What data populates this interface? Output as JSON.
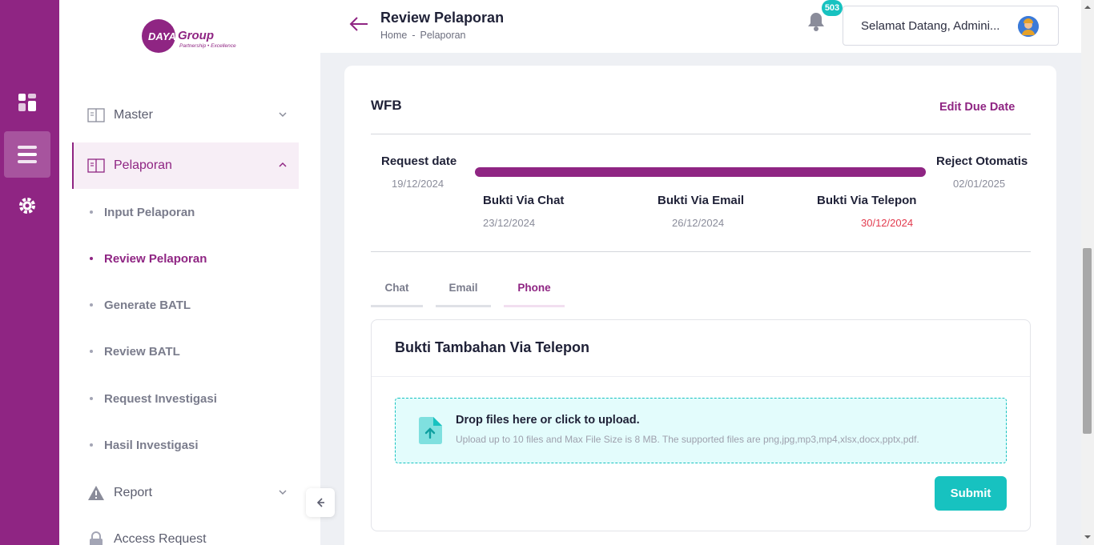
{
  "brand": {
    "logo_text": "DAYA",
    "logo_group": "Group",
    "logo_tagline": "Partnership • Excellence",
    "primary_color": "#8f2583",
    "accent_color": "#17c2c0"
  },
  "rail": {
    "items": [
      {
        "icon": "dashboard-icon",
        "active": false
      },
      {
        "icon": "menu-list-icon",
        "active": true
      },
      {
        "icon": "settings-gear-icon",
        "active": false
      }
    ]
  },
  "sidebar": {
    "items": [
      {
        "label": "Master",
        "icon": "book-icon",
        "expanded": false
      },
      {
        "label": "Pelaporan",
        "icon": "book-icon",
        "expanded": true,
        "active": true
      },
      {
        "label": "Report",
        "icon": "warning-icon",
        "expanded": false
      },
      {
        "label": "Access Request",
        "icon": "lock-icon"
      }
    ],
    "sub_items": [
      {
        "label": "Input Pelaporan",
        "active": false
      },
      {
        "label": "Review Pelaporan",
        "active": true
      },
      {
        "label": "Generate BATL",
        "active": false
      },
      {
        "label": "Review BATL",
        "active": false
      },
      {
        "label": "Request Investigasi",
        "active": false
      },
      {
        "label": "Hasil Investigasi",
        "active": false
      }
    ]
  },
  "header": {
    "title": "Review Pelaporan",
    "breadcrumb": [
      "Home",
      "-",
      "Pelaporan"
    ],
    "notification_count": "503",
    "welcome_text": "Selamat Datang, Admini..."
  },
  "card": {
    "title": "WFB",
    "edit_due_label": "Edit Due Date",
    "timeline": {
      "start": {
        "label": "Request date",
        "date": "19/12/2024"
      },
      "end": {
        "label": "Reject Otomatis",
        "date": "02/01/2025"
      },
      "steps": [
        {
          "label": "Bukti Via Chat",
          "date": "23/12/2024"
        },
        {
          "label": "Bukti Via Email",
          "date": "26/12/2024"
        },
        {
          "label": "Bukti Via Telepon",
          "date": "30/12/2024",
          "overdue": true
        }
      ]
    },
    "tabs": [
      {
        "label": "Chat",
        "active": false
      },
      {
        "label": "Email",
        "active": false
      },
      {
        "label": "Phone",
        "active": true
      }
    ],
    "panel": {
      "title": "Bukti Tambahan Via Telepon",
      "dropzone_title": "Drop files here or click to upload.",
      "dropzone_hint": "Upload up to 10 files and Max File Size is 8 MB. The supported files are png,jpg,mp3,mp4,xlsx,docx,pptx,pdf.",
      "submit_label": "Submit"
    }
  }
}
